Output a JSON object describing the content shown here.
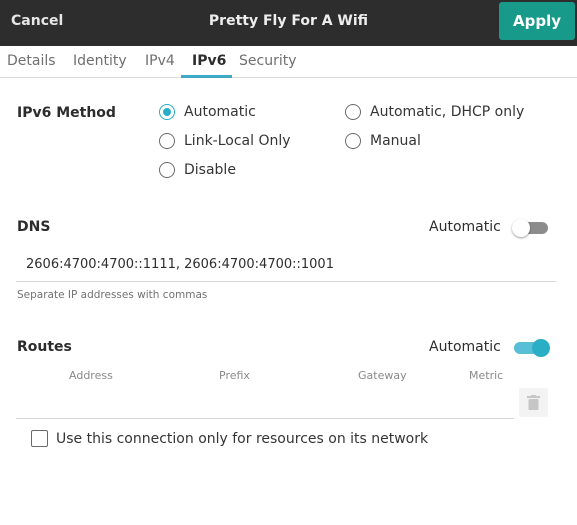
{
  "header": {
    "cancel_label": "Cancel",
    "title": "Pretty Fly For A Wifi",
    "apply_label": "Apply"
  },
  "tabs": [
    {
      "label": "Details",
      "active": false
    },
    {
      "label": "Identity",
      "active": false
    },
    {
      "label": "IPv4",
      "active": false
    },
    {
      "label": "IPv6",
      "active": true
    },
    {
      "label": "Security",
      "active": false
    }
  ],
  "ipv6": {
    "label": "IPv6 Method",
    "options": [
      {
        "label": "Automatic",
        "checked": true
      },
      {
        "label": "Automatic, DHCP only",
        "checked": false
      },
      {
        "label": "Link-Local Only",
        "checked": false
      },
      {
        "label": "Manual",
        "checked": false
      },
      {
        "label": "Disable",
        "checked": false
      }
    ]
  },
  "dns": {
    "label": "DNS",
    "automatic_label": "Automatic",
    "automatic_on": false,
    "value": "2606:4700:4700::1111, 2606:4700:4700::1001",
    "hint": "Separate IP addresses with commas"
  },
  "routes": {
    "label": "Routes",
    "automatic_label": "Automatic",
    "automatic_on": true,
    "columns": [
      "Address",
      "Prefix",
      "Gateway",
      "Metric"
    ]
  },
  "only_resources": {
    "label": "Use this connection only for resources on its network",
    "checked": false
  },
  "colors": {
    "accent": "#2aaec6",
    "apply": "#179a8a",
    "header": "#2d2d2d"
  },
  "icons": {
    "delete": "trash-icon"
  }
}
